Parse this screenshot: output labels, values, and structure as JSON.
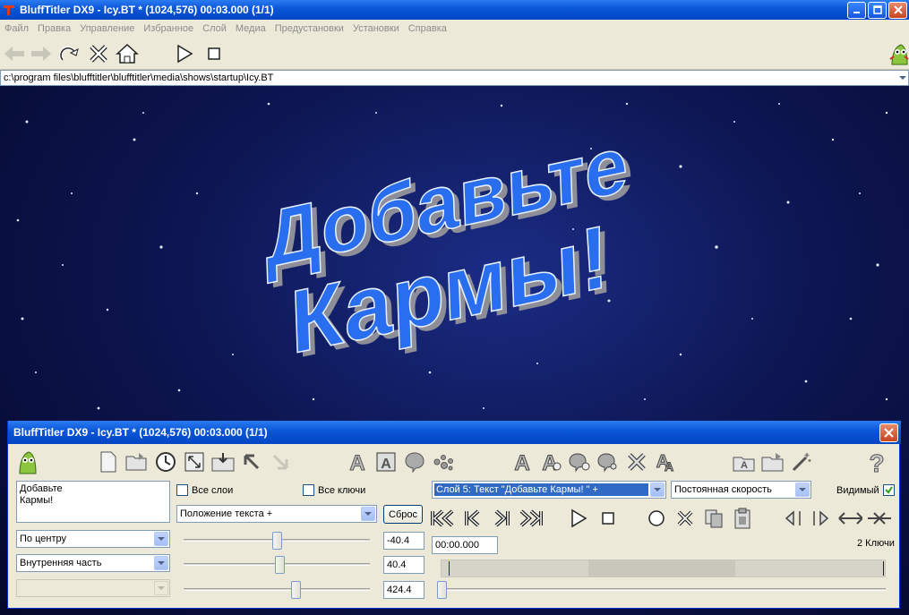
{
  "window": {
    "title": "BluffTitler DX9 - Icy.BT * (1024,576) 00:03.000 (1/1)"
  },
  "menu": [
    "Файл",
    "Правка",
    "Управление",
    "Избранное",
    "Слой",
    "Медиа",
    "Предустановки",
    "Установки",
    "Справка"
  ],
  "path": "c:\\program files\\blufftitler\\blufftitler\\media\\shows\\startup\\Icy.BT",
  "preview": {
    "line1": "Добавьте",
    "line2": "Кармы!"
  },
  "panel": {
    "title": "BluffTitler DX9 - Icy.BT * (1024,576) 00:03.000 (1/1)",
    "text_line1": "Добавьте",
    "text_line2": "Кармы!",
    "all_layers": "Все слои",
    "all_keys": "Все ключи",
    "property": "Положение текста +",
    "reset": "Сброс",
    "align": "По центру",
    "part": "Внутренняя часть",
    "values": [
      "-40.4",
      "40.4",
      "424.4"
    ],
    "slider_levels": [
      0.5,
      0.52,
      0.61
    ],
    "layer": "Слой 5: Текст \"Добавьте Кармы! \" +",
    "speed": "Постоянная скорость",
    "visible": "Видимый",
    "time": "00:00.000",
    "keys": "2 Ключи"
  }
}
